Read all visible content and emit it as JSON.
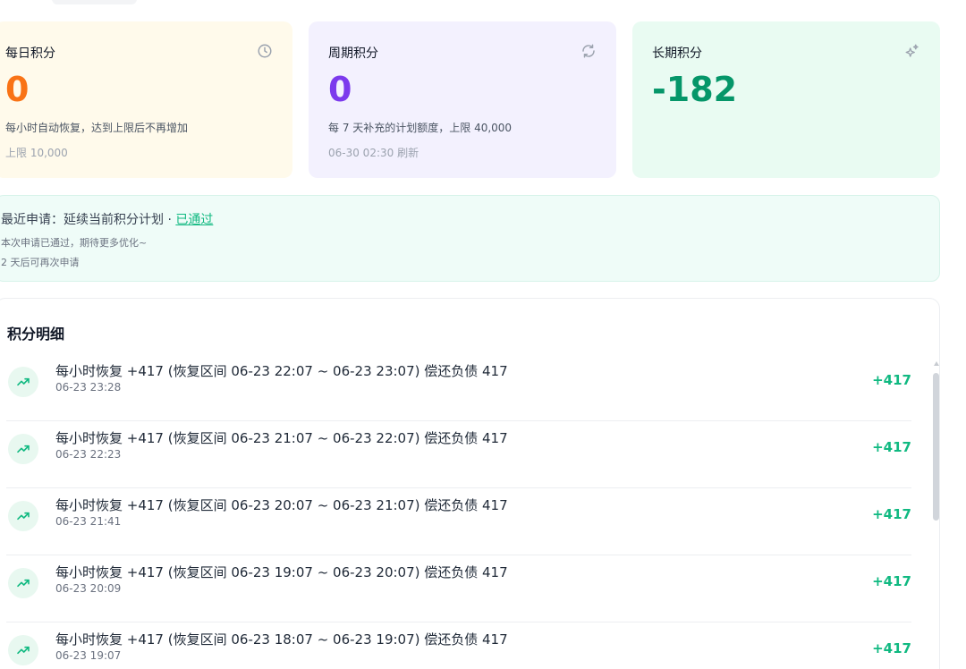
{
  "cards": {
    "daily": {
      "title": "每日积分",
      "icon": "clock-icon",
      "value": "0",
      "description": "每小时自动恢复，达到上限后不再增加",
      "limit": "上限 10,000",
      "color": "#f97316"
    },
    "weekly": {
      "title": "周期积分",
      "icon": "refresh-icon",
      "value": "0",
      "description": "每 7 天补充的计划额度，上限 40,000",
      "refresh": "06-30 02:30 刷新",
      "color": "#7c3aed"
    },
    "longterm": {
      "title": "长期积分",
      "icon": "sparkle-icon",
      "value": "-182",
      "color": "#059669"
    }
  },
  "notice": {
    "prefix": "最近申请：延续当前积分计划 · ",
    "status": "已通过",
    "message": "本次申请已通过，期待更多优化~",
    "cooldown": "2 天后可再次申请"
  },
  "ledger": {
    "title": "积分明细",
    "items": [
      {
        "text": "每小时恢复 +417 (恢复区间 06-23 22:07 ~ 06-23 23:07) 偿还负债 417",
        "time": "06-23 23:28",
        "amount": "+417"
      },
      {
        "text": "每小时恢复 +417 (恢复区间 06-23 21:07 ~ 06-23 22:07) 偿还负债 417",
        "time": "06-23 22:23",
        "amount": "+417"
      },
      {
        "text": "每小时恢复 +417 (恢复区间 06-23 20:07 ~ 06-23 21:07) 偿还负债 417",
        "time": "06-23 21:41",
        "amount": "+417"
      },
      {
        "text": "每小时恢复 +417 (恢复区间 06-23 19:07 ~ 06-23 20:07) 偿还负债 417",
        "time": "06-23 20:09",
        "amount": "+417"
      },
      {
        "text": "每小时恢复 +417 (恢复区间 06-23 18:07 ~ 06-23 19:07) 偿还负债 417",
        "time": "06-23 19:07",
        "amount": "+417"
      }
    ]
  }
}
